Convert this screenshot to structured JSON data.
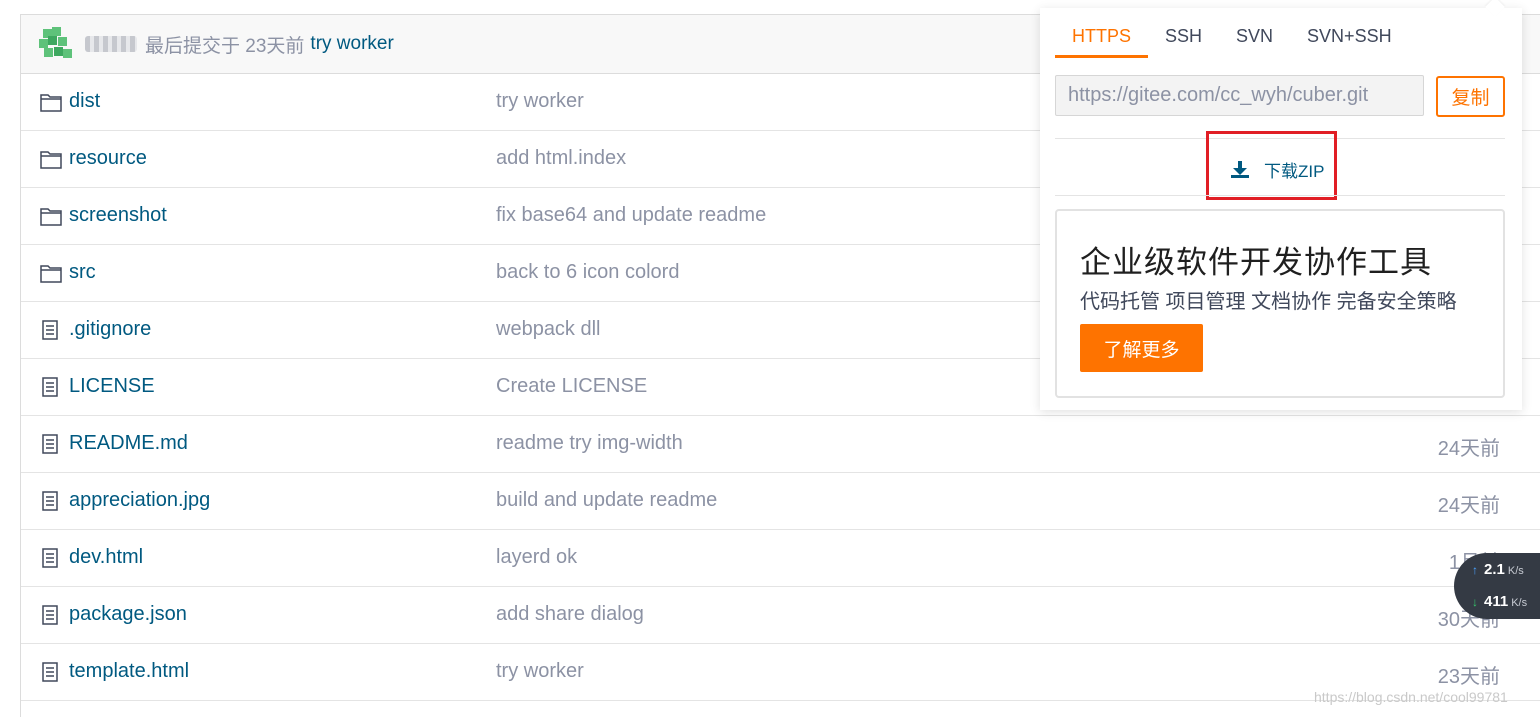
{
  "commit": {
    "meta": "最后提交于 23天前",
    "message": "try worker"
  },
  "files": [
    {
      "type": "folder",
      "name": "dist",
      "message": "try worker",
      "time": ""
    },
    {
      "type": "folder",
      "name": "resource",
      "message": "add html.index",
      "time": ""
    },
    {
      "type": "folder",
      "name": "screenshot",
      "message": "fix base64 and update readme",
      "time": ""
    },
    {
      "type": "folder",
      "name": "src",
      "message": "back to 6 icon colord",
      "time": ""
    },
    {
      "type": "file",
      "name": ".gitignore",
      "message": "webpack dll",
      "time": ""
    },
    {
      "type": "file",
      "name": "LICENSE",
      "message": "Create LICENSE",
      "time": ""
    },
    {
      "type": "file",
      "name": "README.md",
      "message": "readme try img-width",
      "time": "24天前"
    },
    {
      "type": "file",
      "name": "appreciation.jpg",
      "message": "build and update readme",
      "time": "24天前"
    },
    {
      "type": "file",
      "name": "dev.html",
      "message": "layerd ok",
      "time": "1月前"
    },
    {
      "type": "file",
      "name": "package.json",
      "message": "add share dialog",
      "time": "30天前"
    },
    {
      "type": "file",
      "name": "template.html",
      "message": "try worker",
      "time": "23天前"
    }
  ],
  "clone": {
    "tabs": [
      "HTTPS",
      "SSH",
      "SVN",
      "SVN+SSH"
    ],
    "active_tab": "HTTPS",
    "url": "https://gitee.com/cc_wyh/cuber.git",
    "copy_label": "复制",
    "zip_label": "下载ZIP"
  },
  "promo": {
    "title": "企业级软件开发协作工具",
    "subtitle": "代码托管 项目管理 文档协作 完备安全策略",
    "button": "了解更多"
  },
  "net_speed": {
    "up": "2.1",
    "up_unit": "K/s",
    "down": "411",
    "down_unit": "K/s"
  },
  "watermark": "https://blog.csdn.net/cool99781",
  "colors": {
    "accent": "#fe7300",
    "link": "#005980",
    "muted": "#8c92a4",
    "highlight": "#e11e25"
  }
}
